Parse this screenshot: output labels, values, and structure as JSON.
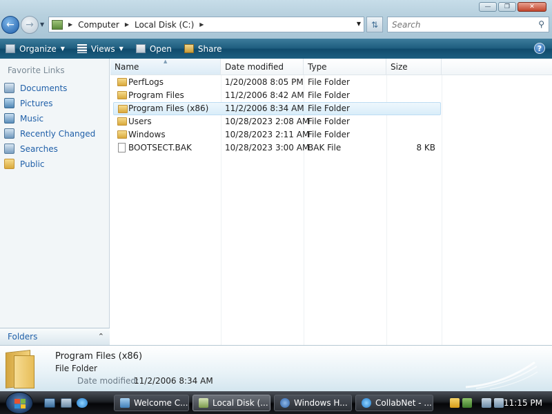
{
  "addressbar": {
    "crumbs": [
      "Computer",
      "Local Disk (C:)"
    ],
    "search_placeholder": "Search"
  },
  "commandbar": {
    "organize": "Organize",
    "views": "Views",
    "open": "Open",
    "share": "Share",
    "help": "?"
  },
  "navpane": {
    "header": "Favorite Links",
    "links": [
      "Documents",
      "Pictures",
      "Music",
      "Recently Changed",
      "Searches",
      "Public"
    ],
    "folders_label": "Folders"
  },
  "filelist": {
    "columns": [
      "Name",
      "Date modified",
      "Type",
      "Size"
    ],
    "rows": [
      {
        "name": "PerfLogs",
        "date": "1/20/2008 8:05 PM",
        "type": "File Folder",
        "size": "",
        "kind": "folder"
      },
      {
        "name": "Program Files",
        "date": "11/2/2006 8:42 AM",
        "type": "File Folder",
        "size": "",
        "kind": "folder"
      },
      {
        "name": "Program Files (x86)",
        "date": "11/2/2006 8:34 AM",
        "type": "File Folder",
        "size": "",
        "kind": "folder"
      },
      {
        "name": "Users",
        "date": "10/28/2023 2:08 AM",
        "type": "File Folder",
        "size": "",
        "kind": "folder"
      },
      {
        "name": "Windows",
        "date": "10/28/2023 2:11 AM",
        "type": "File Folder",
        "size": "",
        "kind": "folder"
      },
      {
        "name": "BOOTSECT.BAK",
        "date": "10/28/2023 3:00 AM",
        "type": "BAK File",
        "size": "8 KB",
        "kind": "file"
      }
    ]
  },
  "details": {
    "name": "Program Files (x86)",
    "type": "File Folder",
    "date_label": "Date modified:",
    "date_value": "11/2/2006 8:34 AM"
  },
  "taskbar": {
    "tasks": [
      "Welcome C...",
      "Local Disk (...",
      "Windows H...",
      "CollabNet - ..."
    ],
    "clock": "11:15 PM"
  },
  "colors": {
    "link_blue": "#1f5fa8",
    "selection": "#d9edf9",
    "command_bar": "#1d5c7d"
  }
}
